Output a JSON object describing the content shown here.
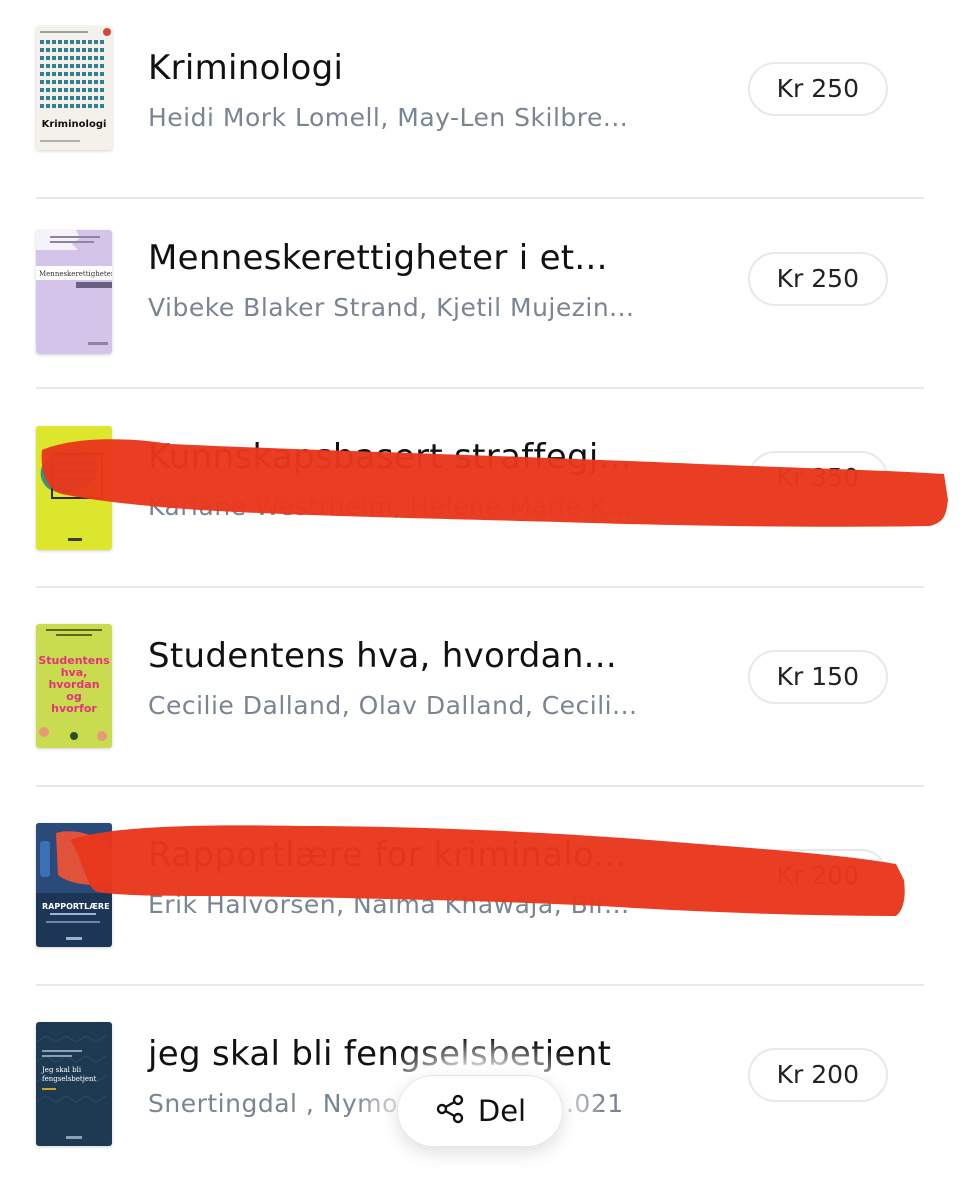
{
  "books": [
    {
      "title": "Kriminologi",
      "authors": "Heidi Mork Lomell, May-Len Skilbre...",
      "price": "Kr 250",
      "cover": {
        "bg": "#f3f1ea",
        "text": "Kriminologi",
        "accent": "#2f7e95"
      }
    },
    {
      "title": "Menneskerettigheter i et...",
      "authors": "Vibeke Blaker Strand, Kjetil Mujezin...",
      "price": "Kr 250",
      "cover": {
        "bg": "#d4c4ea",
        "text": "Menneskerettigheter",
        "accent": "#ffffff"
      }
    },
    {
      "title": "Kunnskapsbasert straffegj...",
      "authors": "Kariane Westrheim, Helene Marie K...",
      "price": "Kr 350",
      "cover": {
        "bg": "#dbe62c",
        "accent": "#1f8f8a"
      },
      "scribbled": true
    },
    {
      "title": "Studentens hva, hvordan...",
      "authors": "Cecilie Dalland, Olav Dalland, Cecili...",
      "price": "Kr 150",
      "cover": {
        "bg": "#c9dc4f",
        "text_lines": [
          "Studentens",
          "hva,",
          "hvordan",
          "og",
          "hvorfor"
        ],
        "accent": "#e0337a"
      }
    },
    {
      "title": "Rapportlære for kriminalo...",
      "authors": "Erik Halvorsen, Naima Khawaja, Bir...",
      "price": "Kr 200",
      "cover": {
        "bg": "#1d3557",
        "text": "RAPPORTLÆRE",
        "accent": "#e0533a"
      },
      "scribbled": true
    },
    {
      "title": "jeg skal bli fengselsbetjent",
      "authors": "Snertingdal , Nymo",
      "authors_tail": ".021",
      "price": "Kr 200",
      "cover": {
        "bg": "#1e3a52",
        "text_lines": [
          "Jeg skal bli",
          "fengselsbetjent"
        ],
        "accent": "#c9a227"
      }
    }
  ],
  "share": {
    "label": "Del",
    "icon": "share-icon"
  },
  "colors": {
    "scribble": "#e8381c",
    "divider": "#e4e9ee",
    "muted_text": "#7a8594"
  }
}
